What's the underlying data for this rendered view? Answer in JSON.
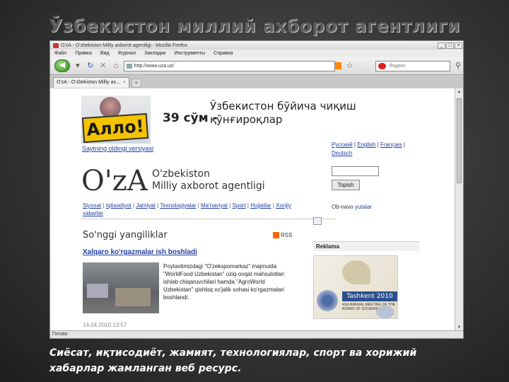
{
  "slide": {
    "title": "Ўзбекистон миллий ахборот агентлиги",
    "caption": "Сиёсат, иқтисодиёт, жамият, технологиялар, спорт ва хорижий хабарлар жамланган веб ресурс."
  },
  "browser": {
    "window_title": "O'zA - O'zbekiston Milliy axborot agentligi - Mozilla Firefox",
    "window_buttons": [
      "_",
      "□",
      "×"
    ],
    "menu": [
      "Файл",
      "Правка",
      "Вид",
      "Журнал",
      "Закладки",
      "Инструменты",
      "Справка"
    ],
    "url": "http://www.uza.uz/",
    "search_placeholder": "Яндекс",
    "tab_label": "O'zA - O'zbekiston Milliy ax...",
    "tab_new": "+",
    "status": "Готово"
  },
  "page": {
    "banner": {
      "logo_text": "Алло!",
      "price": "39 сўм -",
      "promo": "Ўзбекистон бўйича чиқиш қўнғироқлар"
    },
    "version_link": "Saytning oldingi versiyasi",
    "languages": [
      "Русский",
      "English",
      "Français",
      "Deutsch"
    ],
    "oza_logo": "O'zA",
    "oza_name_line1": "O'zbekiston",
    "oza_name_line2": "Milliy axborot agentligi",
    "search_button": "Topish",
    "nav": [
      "Siyosat",
      "Iqtisodiyot",
      "Jamiyat",
      "Texnologiyalar",
      "Ma'naviyat",
      "Sport",
      "Hujjatlar",
      "Xorijiy xabarlar"
    ],
    "obnavlenie": "Ob-navo",
    "obnavlenie_link": "yutalar",
    "latest_heading": "So'nggi yangiliklar",
    "rss_label": "RSS",
    "headline": "Xalqaro ko'rgazmalar ish boshladi",
    "news_text": "Poytaxtimizdagi \"O'zekspomarkaz\" majmuida \"WorldFood Uzbekistan\" oziq-ovqat mahsulotlari ishlab chiqaruvchilari hamda \"AgroWorld Uzbekistan\" qishloq xo'jalik sohasi ko'rgazmalari boshlandi.",
    "date_line": "14.04.2010 13:57",
    "reklama": "Reklama",
    "ad": {
      "title": "Tashkent 2010",
      "subtitle": "43rd ANNUAL MEETING OF THE BOARD OF GOVERNORS"
    }
  }
}
